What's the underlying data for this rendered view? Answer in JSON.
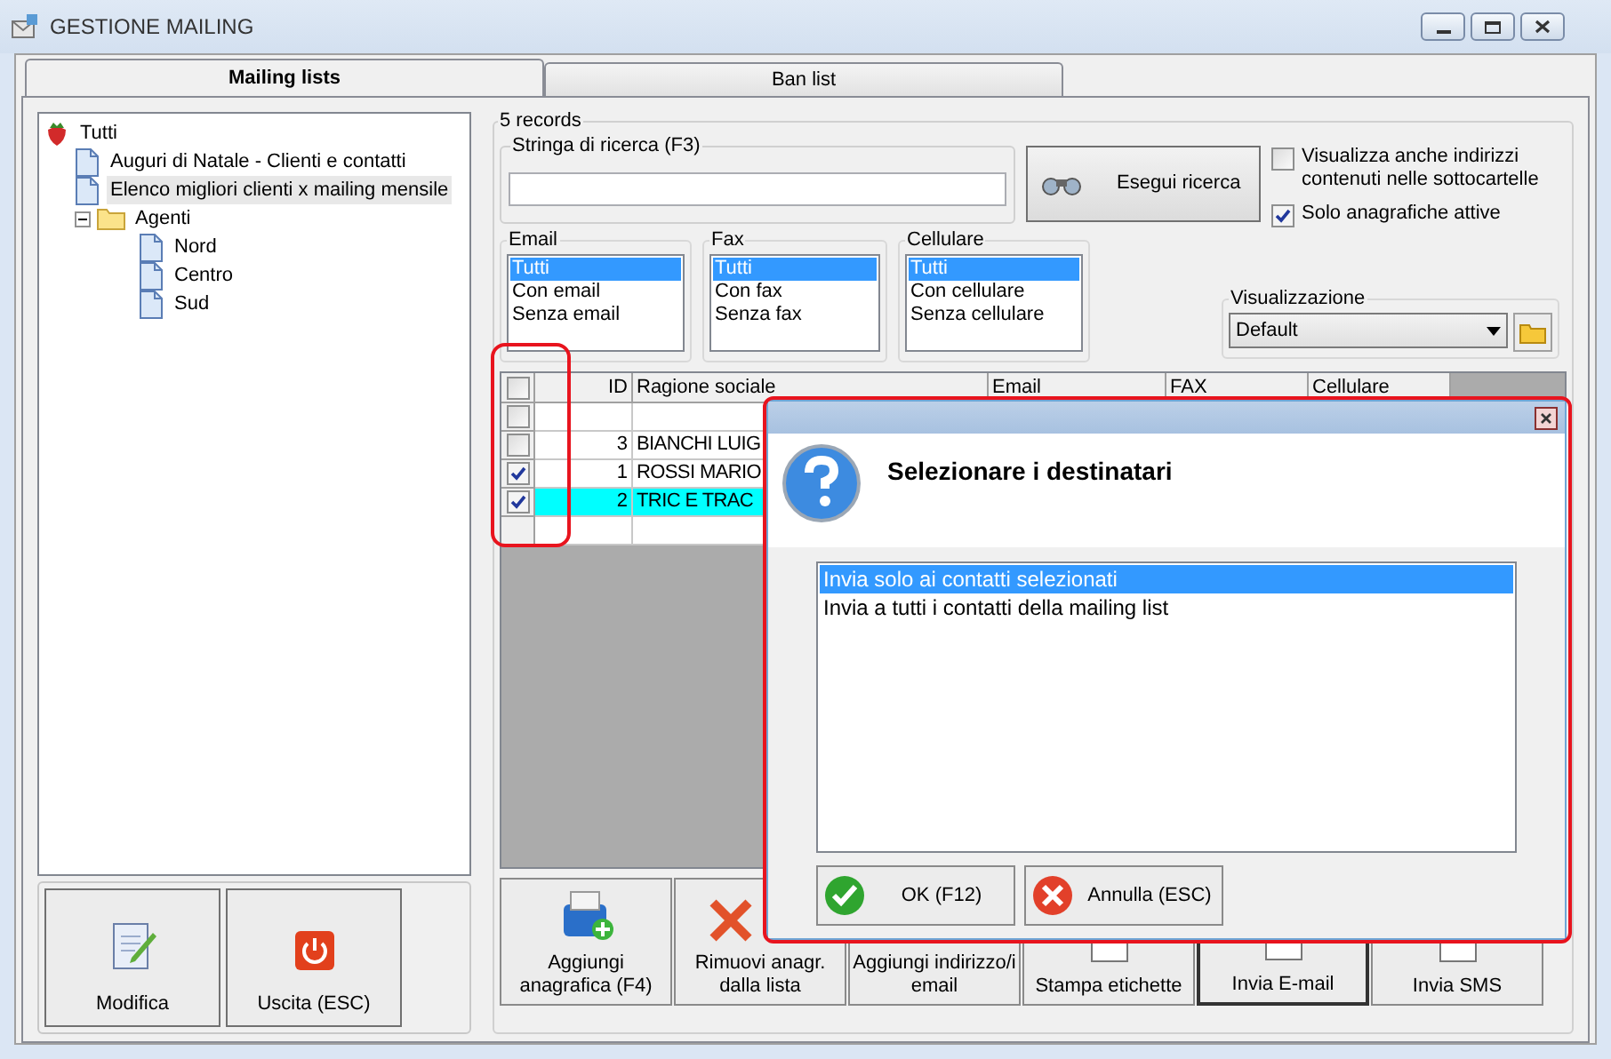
{
  "window": {
    "title": "GESTIONE MAILING"
  },
  "tabs": [
    {
      "label": "Mailing lists",
      "selected": true
    },
    {
      "label": "Ban list",
      "selected": false
    }
  ],
  "tree": [
    {
      "label": "Tutti",
      "kind": "root",
      "selected": false,
      "children": [
        {
          "label": "Auguri di Natale - Clienti e contatti",
          "kind": "list",
          "selected": false
        },
        {
          "label": "Elenco migliori clienti x mailing mensile",
          "kind": "list",
          "selected": true
        },
        {
          "label": "Agenti",
          "kind": "folder",
          "selected": false,
          "expanded": true,
          "children": [
            {
              "label": "Nord",
              "kind": "list",
              "selected": false
            },
            {
              "label": "Centro",
              "kind": "list",
              "selected": false
            },
            {
              "label": "Sud",
              "kind": "list",
              "selected": false
            }
          ]
        }
      ]
    }
  ],
  "left_buttons": [
    {
      "label": "Modifica",
      "kind": "edit"
    },
    {
      "label": "Uscita (ESC)",
      "kind": "exit"
    }
  ],
  "records_label": "5 records",
  "search": {
    "label": "Stringa di ricerca (F3)",
    "button": "Esegui ricerca"
  },
  "options": [
    {
      "label": "Visualizza anche indirizzi contenuti nelle sottocartelle",
      "checked": false
    },
    {
      "label": "Solo anagrafiche attive",
      "checked": true
    }
  ],
  "filters": [
    {
      "title": "Email",
      "items": [
        {
          "label": "Tutti",
          "selected": true
        },
        {
          "label": "Con email",
          "selected": false
        },
        {
          "label": "Senza email",
          "selected": false
        }
      ]
    },
    {
      "title": "Fax",
      "items": [
        {
          "label": "Tutti",
          "selected": true
        },
        {
          "label": "Con fax",
          "selected": false
        },
        {
          "label": "Senza fax",
          "selected": false
        }
      ]
    },
    {
      "title": "Cellulare",
      "items": [
        {
          "label": "Tutti",
          "selected": true
        },
        {
          "label": "Con cellulare",
          "selected": false
        },
        {
          "label": "Senza cellulare",
          "selected": false
        }
      ]
    }
  ],
  "view": {
    "label": "Visualizzazione",
    "value": "Default"
  },
  "grid": {
    "header_checked": false,
    "columns": [
      "ID",
      "Ragione sociale",
      "Email",
      "FAX",
      "Cellulare"
    ],
    "rows": [
      {
        "kind": "record",
        "checked": false,
        "selected": false
      },
      {
        "kind": "record",
        "checked": false,
        "selected": false,
        "id": "3",
        "name": "BIANCHI LUIG"
      },
      {
        "kind": "record",
        "checked": true,
        "selected": false,
        "id": "1",
        "name": "ROSSI MARIO"
      },
      {
        "kind": "record",
        "checked": true,
        "selected": true,
        "id": "2",
        "name": "TRIC E TRAC"
      },
      {
        "kind": "new",
        "selected": false
      }
    ]
  },
  "actions": [
    {
      "label": "Aggiungi anagrafica (F4)",
      "kind": "add",
      "focused": false
    },
    {
      "label": "Rimuovi anagr. dalla lista",
      "kind": "remove",
      "focused": false
    },
    {
      "label": "Aggiungi indirizzo/i email",
      "kind": "address",
      "focused": false
    },
    {
      "label": "Stampa etichette",
      "kind": "print",
      "focused": false
    },
    {
      "label": "Invia E-mail",
      "kind": "email",
      "focused": true
    },
    {
      "label": "Invia SMS",
      "kind": "sms",
      "focused": false
    }
  ],
  "dialog": {
    "title": "Selezionare i destinatari",
    "options": [
      {
        "label": "Invia solo ai contatti selezionati",
        "selected": true
      },
      {
        "label": "Invia a tutti i contatti della mailing list",
        "selected": false
      }
    ],
    "buttons": [
      {
        "label": "OK (F12)",
        "kind": "ok"
      },
      {
        "label": "Annulla (ESC)",
        "kind": "cancel"
      }
    ]
  }
}
